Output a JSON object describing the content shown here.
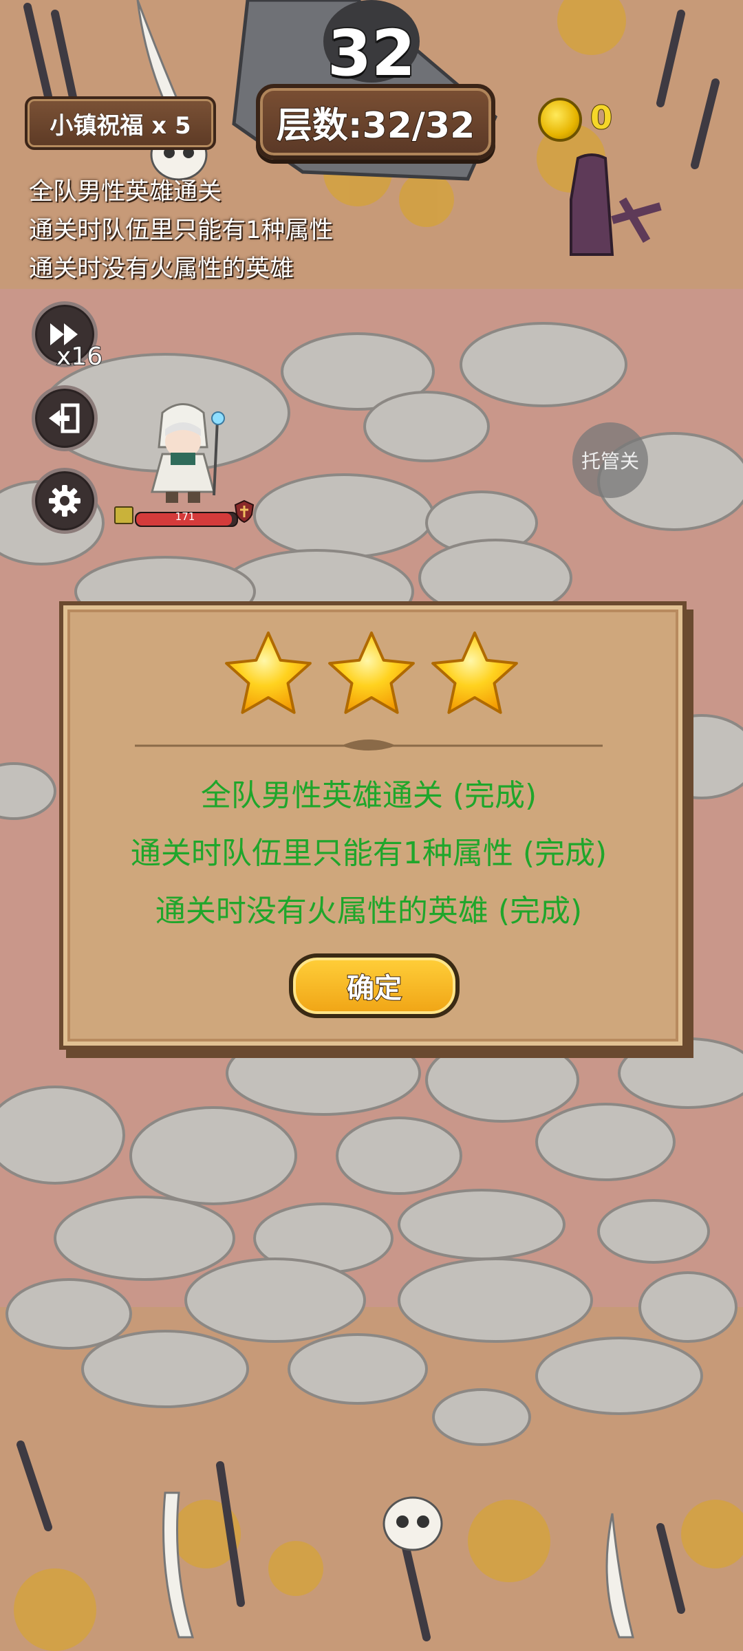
{
  "hud": {
    "level": "32",
    "floor_text": "层数:32/32",
    "blessing": "小镇祝福 x 5",
    "coins": "0"
  },
  "objectives": [
    "全队男性英雄通关",
    "通关时队伍里只能有1种属性",
    "通关时没有火属性的英雄"
  ],
  "controls": {
    "speed_label": "x16",
    "auto_label": "托管关"
  },
  "hero": {
    "hp": "171",
    "hp_fraction": 0.95
  },
  "result": {
    "stars_earned": 3,
    "lines": [
      "全队男性英雄通关 (完成)",
      "通关时队伍里只能有1种属性 (完成)",
      "通关时没有火属性的英雄 (完成)"
    ],
    "confirm_label": "确定"
  },
  "colors": {
    "complete_text": "#1fa62b",
    "star": "#ffc21a",
    "dialog": "#cfa77c"
  }
}
